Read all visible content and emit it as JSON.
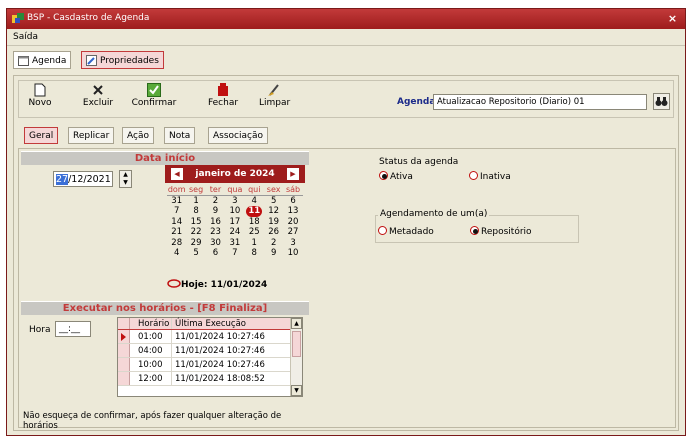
{
  "window": {
    "title": "BSP - Casdastro de Agenda",
    "close_glyph": "×"
  },
  "menu": {
    "items": [
      {
        "label": "Saída"
      }
    ]
  },
  "tabs": [
    {
      "label": "Agenda"
    },
    {
      "label": "Propriedades"
    }
  ],
  "toolbar": {
    "novo": "Novo",
    "excluir": "Excluir",
    "confirmar": "Confirmar",
    "fechar": "Fechar",
    "limpar": "Limpar"
  },
  "agenda": {
    "label": "Agenda",
    "value": "Atualizacao Repositorio (Diario) 01"
  },
  "subtabs": [
    {
      "label": "Geral"
    },
    {
      "label": "Replicar"
    },
    {
      "label": "Ação"
    },
    {
      "label": "Nota"
    },
    {
      "label": "Associação"
    }
  ],
  "data_inicio": {
    "header": "Data início",
    "date_selected": "27",
    "date_rest": "/12/2021"
  },
  "calendar": {
    "month_label": "janeiro de 2024",
    "weekdays": [
      "dom",
      "seg",
      "ter",
      "qua",
      "qui",
      "sex",
      "sáb"
    ],
    "weeks": [
      [
        "31",
        "1",
        "2",
        "3",
        "4",
        "5",
        "6"
      ],
      [
        "7",
        "8",
        "9",
        "10",
        "11",
        "12",
        "13"
      ],
      [
        "14",
        "15",
        "16",
        "17",
        "18",
        "19",
        "20"
      ],
      [
        "21",
        "22",
        "23",
        "24",
        "25",
        "26",
        "27"
      ],
      [
        "28",
        "29",
        "30",
        "31",
        "1",
        "2",
        "3"
      ],
      [
        "4",
        "5",
        "6",
        "7",
        "8",
        "9",
        "10"
      ]
    ],
    "today_day": "11",
    "today_label": "Hoje: 11/01/2024"
  },
  "horarios": {
    "header": "Executar nos horários - [F8 Finaliza]",
    "hora_label": "Hora",
    "hora_value": "__:__",
    "columns": [
      "Horário",
      "Última Execução"
    ],
    "rows": [
      {
        "horario": "01:00",
        "execucao": "11/01/2024 10:27:46"
      },
      {
        "horario": "04:00",
        "execucao": "11/01/2024 10:27:46"
      },
      {
        "horario": "10:00",
        "execucao": "11/01/2024 10:27:46"
      },
      {
        "horario": "12:00",
        "execucao": "11/01/2024 18:08:52"
      }
    ],
    "note": "Não esqueça de confirmar, após fazer qualquer alteração de horários"
  },
  "status": {
    "title": "Status da agenda",
    "options": [
      {
        "label": "Ativa",
        "selected": true
      },
      {
        "label": "Inativa",
        "selected": false
      }
    ]
  },
  "agendamento": {
    "title": "Agendamento de um(a)",
    "options": [
      {
        "label": "Metadado",
        "selected": false
      },
      {
        "label": "Repositório",
        "selected": true
      }
    ]
  },
  "colors": {
    "accent": "#c23a3a",
    "title_bar": "#9e1c1c",
    "panel_bg": "#ece9d8"
  }
}
